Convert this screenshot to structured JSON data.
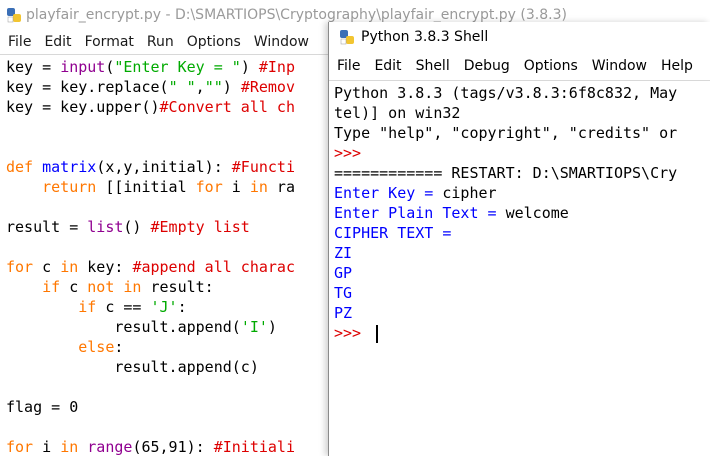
{
  "editor": {
    "title": "playfair_encrypt.py - D:\\SMARTIOPS\\Cryptography\\playfair_encrypt.py (3.8.3)",
    "menu": [
      "File",
      "Edit",
      "Format",
      "Run",
      "Options",
      "Window"
    ],
    "code": {
      "l1": {
        "a": "key = ",
        "b": "input",
        "c": "(",
        "d": "\"Enter Key = \"",
        "e": ") ",
        "f": "#Inp"
      },
      "l2": {
        "a": "key = key.replace(",
        "b": "\" \"",
        "c": ",",
        "d": "\"\"",
        "e": ") ",
        "f": "#Remov"
      },
      "l3": {
        "a": "key = key.upper()",
        "b": "#Convert all ch"
      },
      "l4": {
        "a": "def ",
        "b": "matrix",
        "c": "(x,y,initial): ",
        "d": "#Functi"
      },
      "l5": {
        "a": "    ",
        "b": "return",
        "c": " [[initial ",
        "d": "for",
        "e": " i ",
        "f": "in",
        "g": " ra"
      },
      "l6": {
        "a": "result = ",
        "b": "list",
        "c": "() ",
        "d": "#Empty list"
      },
      "l7": {
        "a": "for",
        "b": " c ",
        "c": "in",
        "d": " key: ",
        "e": "#append all charac"
      },
      "l8": {
        "a": "    ",
        "b": "if",
        "c": " c ",
        "d": "not in",
        "e": " result:"
      },
      "l9": {
        "a": "        ",
        "b": "if",
        "c": " c == ",
        "d": "'J'",
        "e": ":"
      },
      "l10": {
        "a": "            result.append(",
        "b": "'I'",
        "c": ")"
      },
      "l11": {
        "a": "        ",
        "b": "else",
        "c": ":"
      },
      "l12": {
        "a": "            result.append(c)"
      },
      "l13": {
        "a": "flag = 0"
      },
      "l14": {
        "a": "for",
        "b": " i ",
        "c": "in",
        "d": " ",
        "e": "range",
        "f": "(65,91): ",
        "g": "#Initiali"
      }
    }
  },
  "shell": {
    "title": "Python 3.8.3 Shell",
    "menu": [
      "File",
      "Edit",
      "Shell",
      "Debug",
      "Options",
      "Window",
      "Help"
    ],
    "lines": {
      "banner1": "Python 3.8.3 (tags/v3.8.3:6f8c832, May",
      "banner2": "tel)] on win32",
      "banner3": "Type \"help\", \"copyright\", \"credits\" or",
      "prompt1": ">>> ",
      "restart": "============ RESTART: D:\\SMARTIOPS\\Cry",
      "key": "Enter Key = ",
      "key_value": "cipher",
      "plain": "Enter Plain Text = ",
      "plain_value": "welcome",
      "cipher_label": "CIPHER TEXT = ",
      "out1": "ZI",
      "out2": "GP",
      "out3": "TG",
      "out4": "PZ",
      "prompt2": ">>> "
    }
  },
  "colors": {
    "keyword": "#ff7700",
    "builtin": "#900090",
    "string": "#00aa00",
    "comment": "#dd0000",
    "output_blue": "#0000ff"
  },
  "icons": [
    "python-idle-icon"
  ]
}
